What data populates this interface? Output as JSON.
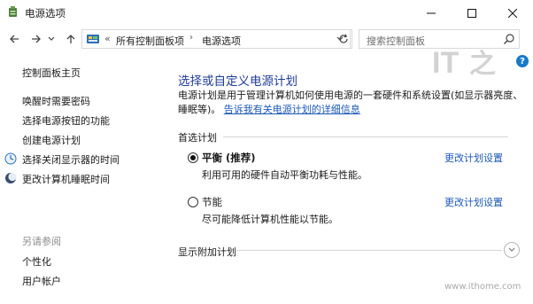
{
  "window": {
    "title": "电源选项",
    "icon": "power-options-icon",
    "controls": [
      "minimize-icon",
      "maximize-icon",
      "close-icon"
    ]
  },
  "navbar": {
    "breadcrumb_sep": "«",
    "breadcrumb": [
      "所有控制面板项",
      "电源选项"
    ],
    "crumb_sep": "›",
    "search_placeholder": "搜索控制面板"
  },
  "sidebar": {
    "home": "控制面板主页",
    "links": [
      {
        "label": "唤醒时需要密码",
        "icon": ""
      },
      {
        "label": "选择电源按钮的功能",
        "icon": ""
      },
      {
        "label": "创建电源计划",
        "icon": ""
      },
      {
        "label": "选择关闭显示器的时间",
        "icon": "display-timer-icon"
      },
      {
        "label": "更改计算机睡眠时间",
        "icon": "sleep-moon-icon"
      }
    ],
    "see_also_heading": "另请参阅",
    "see_also": [
      "个性化",
      "用户帐户"
    ]
  },
  "main": {
    "title": "选择或自定义电源计划",
    "description": "电源计划是用于管理计算机如何使用电源的一套硬件和系统设置(如显示器亮度、睡眠等)。",
    "learn_more": "告诉我有关电源计划的详细信息",
    "preferred_label": "首选计划",
    "plans": [
      {
        "name": "平衡 (推荐)",
        "desc": "利用可用的硬件自动平衡功耗与性能。",
        "link": "更改计划设置",
        "selected": true
      },
      {
        "name": "节能",
        "desc": "尽可能降低计算机性能以节能。",
        "link": "更改计划设置",
        "selected": false
      }
    ],
    "extra_label": "显示附加计划"
  },
  "logo_text": "IT之家",
  "watermark": "www.ithome.com",
  "colors": {
    "accent": "#1b57b7",
    "title": "#1f3c96",
    "help": "#1979ca"
  }
}
